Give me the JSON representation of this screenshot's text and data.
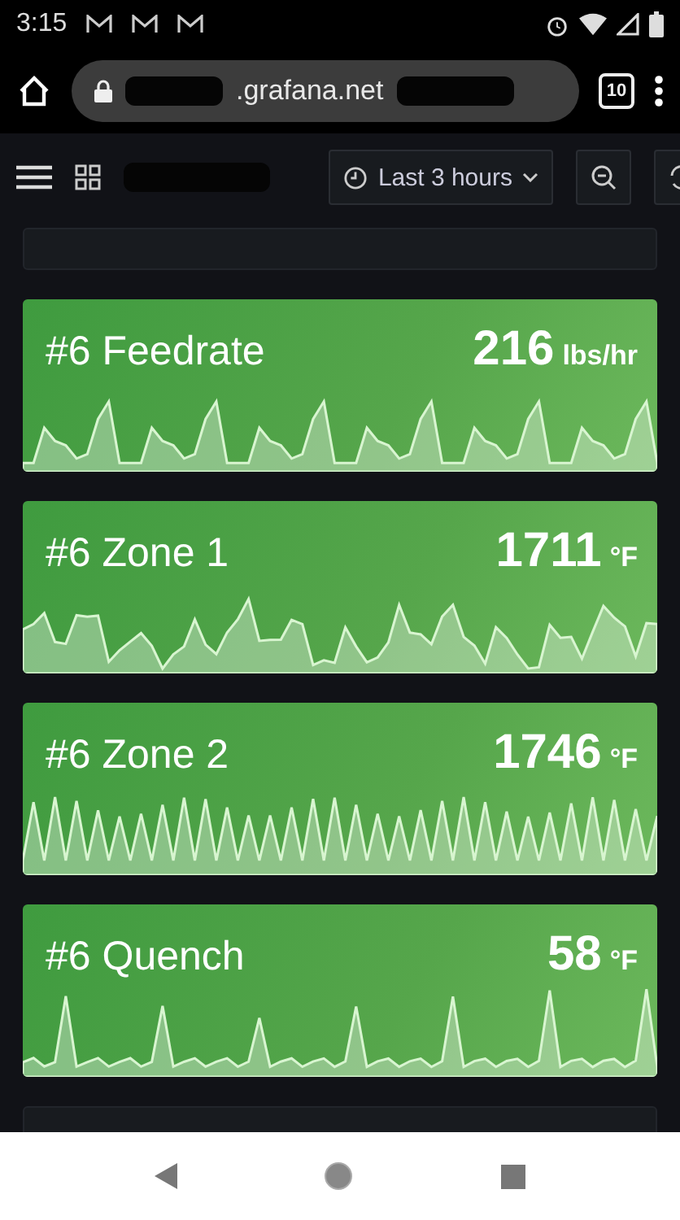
{
  "status_bar": {
    "time": "3:15"
  },
  "browser": {
    "url": ".grafana.net",
    "tab_count": "10"
  },
  "toolbar": {
    "time_range": "Last 3 hours"
  },
  "panels": [
    {
      "title": "#6 Feedrate",
      "value": "216",
      "unit": "lbs/hr",
      "kind": "spiky"
    },
    {
      "title": "#6 Zone 1",
      "value": "1711",
      "unit": "°F",
      "kind": "noisy"
    },
    {
      "title": "#6 Zone 2",
      "value": "1746",
      "unit": "°F",
      "kind": "wave"
    },
    {
      "title": "#6 Quench",
      "value": "58",
      "unit": "°F",
      "kind": "pulse"
    }
  ]
}
